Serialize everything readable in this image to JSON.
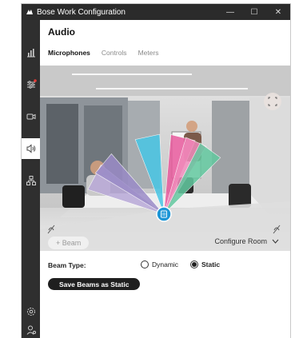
{
  "window": {
    "title": "Bose Work Configuration",
    "controls": {
      "minimize": "—",
      "maximize": "☐",
      "close": "✕"
    }
  },
  "sidebar": {
    "items": [
      {
        "icon": "bar-chart-icon"
      },
      {
        "icon": "sliders-icon"
      },
      {
        "icon": "camera-icon"
      },
      {
        "icon": "audio-icon"
      },
      {
        "icon": "network-icon"
      }
    ],
    "bottom": [
      {
        "icon": "gear-icon"
      },
      {
        "icon": "user-icon"
      }
    ]
  },
  "page": {
    "title": "Audio"
  },
  "tabs": [
    {
      "label": "Microphones",
      "active": true
    },
    {
      "label": "Controls",
      "active": false
    },
    {
      "label": "Meters",
      "active": false
    }
  ],
  "beams": {
    "add_label": "+ Beam",
    "configure_label": "Configure Room",
    "colors": [
      "#b9a9d8",
      "#9b8cc8",
      "#49c6e5",
      "#e95a9d",
      "#f08bbb",
      "#63c9a0"
    ]
  },
  "beam_type": {
    "label": "Beam Type:",
    "options": [
      {
        "label": "Dynamic",
        "selected": false
      },
      {
        "label": "Static",
        "selected": true
      }
    ]
  },
  "actions": {
    "save_label": "Save Beams as Static"
  }
}
